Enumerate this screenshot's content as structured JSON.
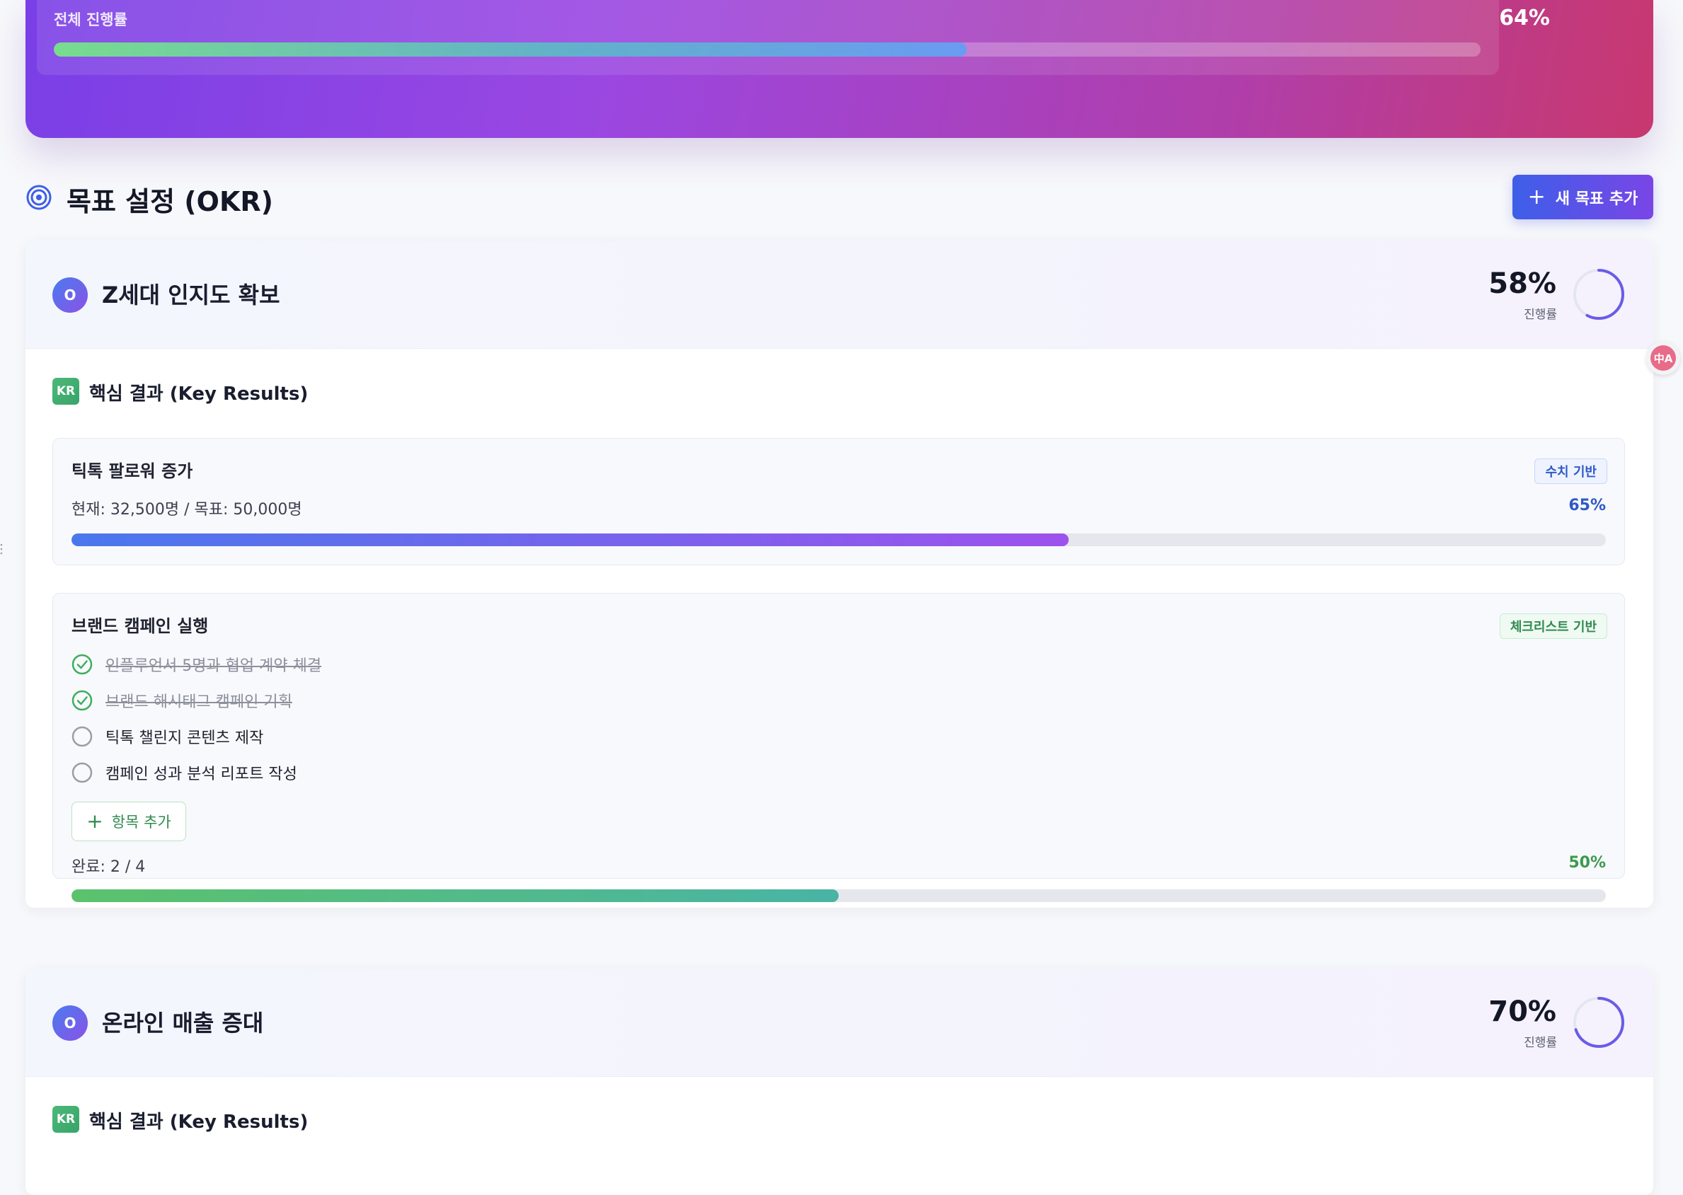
{
  "hero": {
    "overall_label": "전체 진행률",
    "overall_pct_text": "64%",
    "overall_progress": 0.64
  },
  "section": {
    "title": "목표 설정 (OKR)",
    "add_goal_label": "새 목표 추가",
    "icon": "target-icon"
  },
  "objectives": [
    {
      "badge": "O",
      "title": "Z세대 인지도 확보",
      "pct_text": "58%",
      "progress_label": "진행률",
      "progress": 0.58,
      "kr_badge": "KR",
      "kr_header": "핵심 결과 (Key Results)",
      "key_results": [
        {
          "name": "틱톡 팔로워 증가",
          "tag": "수치 기반",
          "meta": "현재: 32,500명 / 목표: 50,000명",
          "pct_text": "65%",
          "progress": 0.65
        },
        {
          "name": "브랜드 캠페인 실행",
          "tag": "체크리스트 기반",
          "items": [
            {
              "text": "인플루언서 5명과 협업 계약 체결",
              "done": true
            },
            {
              "text": "브랜드 해시태그 캠페인 기획",
              "done": true
            },
            {
              "text": "틱톡 챌린지 콘텐츠 제작",
              "done": false
            },
            {
              "text": "캠페인 성과 분석 리포트 작성",
              "done": false
            }
          ],
          "add_item_label": "항목 추가",
          "meta": "완료: 2 / 4",
          "pct_text": "50%",
          "progress": 0.5
        }
      ]
    },
    {
      "badge": "O",
      "title": "온라인 매출 증대",
      "pct_text": "70%",
      "progress_label": "진행률",
      "progress": 0.7,
      "kr_badge": "KR",
      "kr_header": "핵심 결과 (Key Results)"
    }
  ],
  "colors": {
    "primary_blue": "#3d5fe8",
    "purple": "#7a45e6",
    "green": "#2f8a4f",
    "pct_blue": "#2f59c8"
  },
  "floating": {
    "icon": "translate-icon",
    "glyph": "中A"
  }
}
